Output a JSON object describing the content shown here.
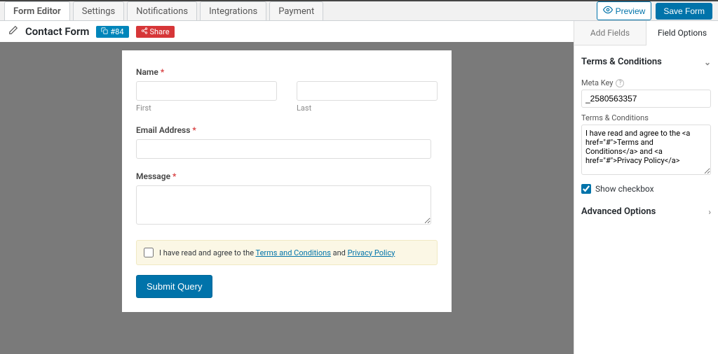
{
  "top_tabs": {
    "editor": "Form Editor",
    "settings": "Settings",
    "notifications": "Notifications",
    "integrations": "Integrations",
    "payment": "Payment"
  },
  "actions": {
    "preview": "Preview",
    "save": "Save Form"
  },
  "form": {
    "title": "Contact Form",
    "id_badge": "#84",
    "share_badge": "Share"
  },
  "fields": {
    "name_label": "Name",
    "first_sub": "First",
    "last_sub": "Last",
    "email_label": "Email Address",
    "message_label": "Message"
  },
  "consent": {
    "prefix": "I have read and agree to the ",
    "terms_link": "Terms and Conditions",
    "joiner": " and ",
    "privacy_link": "Privacy Policy"
  },
  "submit_label": "Submit Query",
  "panel": {
    "tab_add": "Add Fields",
    "tab_options": "Field Options",
    "section_terms": "Terms & Conditions",
    "meta_key_label": "Meta Key",
    "meta_key_value": "_2580563357",
    "tc_label": "Terms & Conditions",
    "tc_value": "I have read and agree to the <a href=\"#\">Terms and Conditions</a> and <a href=\"#\">Privacy Policy</a>",
    "show_checkbox": "Show checkbox",
    "section_advanced": "Advanced Options"
  }
}
